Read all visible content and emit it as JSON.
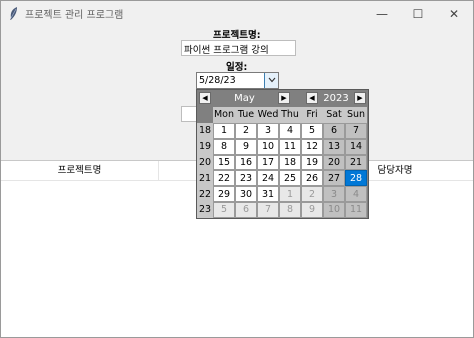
{
  "window": {
    "title": "프로젝트 관리 프로그램",
    "minimize_glyph": "—",
    "maximize_glyph": "☐",
    "close_glyph": "✕",
    "icon": "feather-icon"
  },
  "form": {
    "project_label": "프로젝트명:",
    "project_value": "파이썬 프로그램 강의",
    "schedule_label": "일정:",
    "date_value": "5/28/23",
    "date_dropdown_icon": "chevron-down-icon",
    "third_value": ""
  },
  "table": {
    "columns": [
      "프로젝트명",
      "",
      "담당자명"
    ]
  },
  "calendar": {
    "month": "May",
    "year": "2023",
    "prev_glyph": "◀",
    "next_glyph": "▶",
    "weekdays": [
      "Mon",
      "Tue",
      "Wed",
      "Thu",
      "Fri",
      "Sat",
      "Sun"
    ],
    "weeks": [
      {
        "num": "18",
        "days": [
          "1",
          "2",
          "3",
          "4",
          "5",
          "6",
          "7"
        ]
      },
      {
        "num": "19",
        "days": [
          "8",
          "9",
          "10",
          "11",
          "12",
          "13",
          "14"
        ]
      },
      {
        "num": "20",
        "days": [
          "15",
          "16",
          "17",
          "18",
          "19",
          "20",
          "21"
        ]
      },
      {
        "num": "21",
        "days": [
          "22",
          "23",
          "24",
          "25",
          "26",
          "27",
          "28"
        ]
      },
      {
        "num": "22",
        "days": [
          "29",
          "30",
          "31",
          "1",
          "2",
          "3",
          "4"
        ]
      },
      {
        "num": "23",
        "days": [
          "5",
          "6",
          "7",
          "8",
          "9",
          "10",
          "11"
        ]
      }
    ],
    "selected_day": "28",
    "accent_color": "#0078d7"
  }
}
